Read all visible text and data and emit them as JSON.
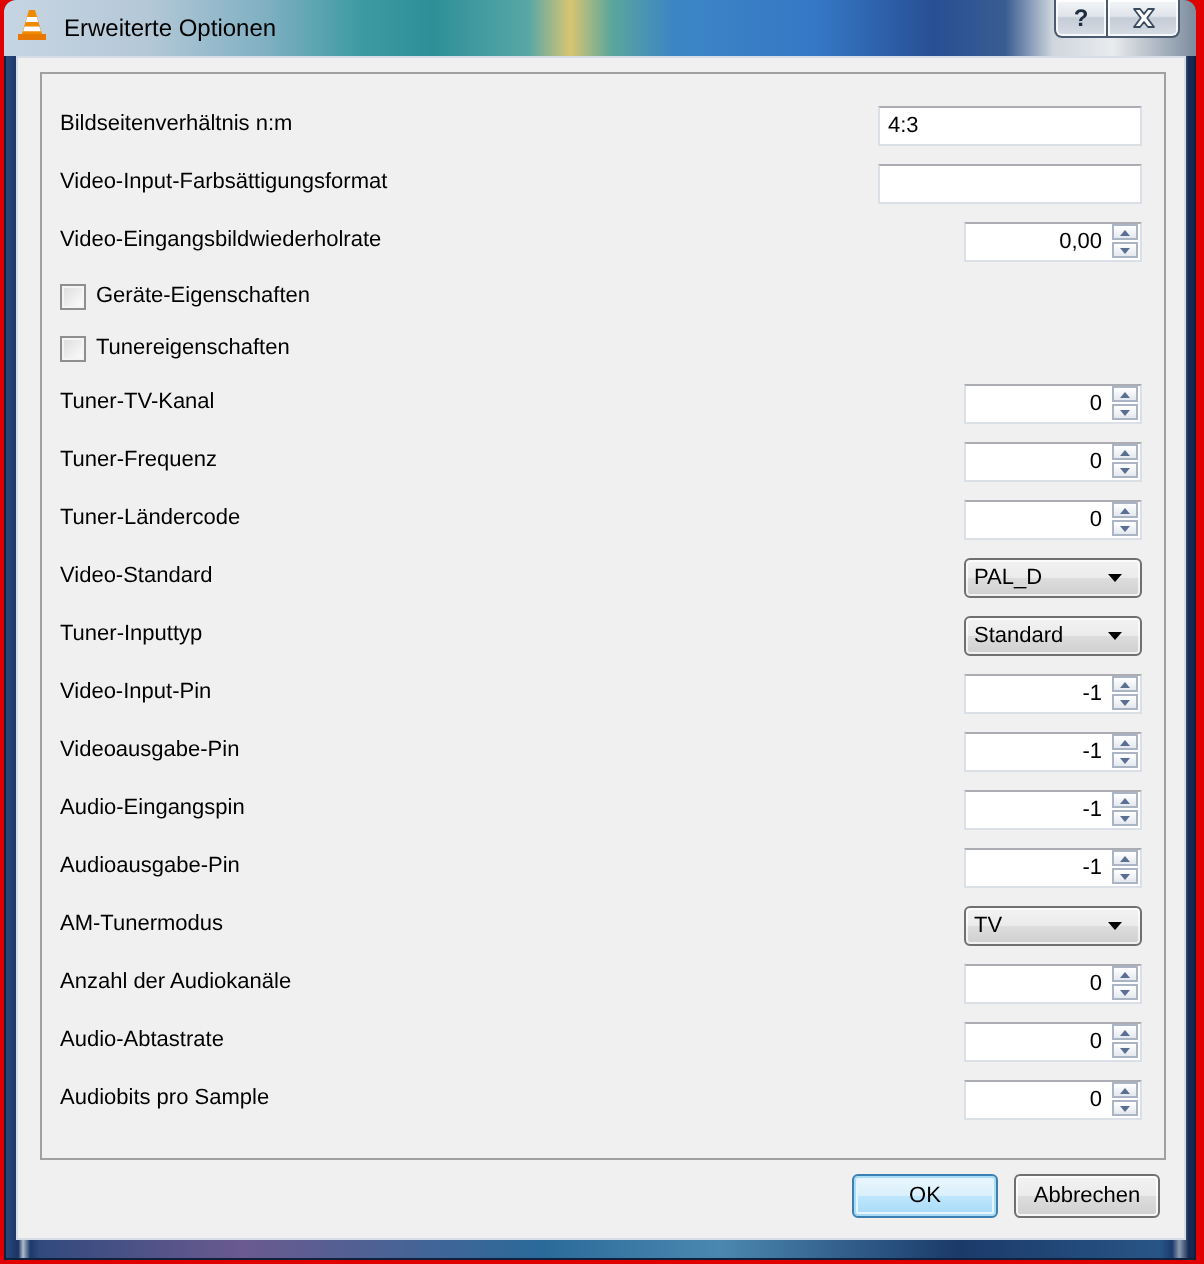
{
  "window": {
    "title": "Erweiterte Optionen",
    "help_button": "?"
  },
  "options": [
    {
      "kind": "text",
      "label": "Bildseitenverhältnis n:m",
      "value": "4:3"
    },
    {
      "kind": "text",
      "label": "Video-Input-Farbsättigungsformat"
    },
    {
      "kind": "spin",
      "label": "Video-Eingangsbildwiederholrate",
      "value": "0,00"
    },
    {
      "kind": "checkbox",
      "label": "Geräte-Eigenschaften",
      "checked": false
    },
    {
      "kind": "checkbox",
      "label": "Tunereigenschaften",
      "checked": false
    },
    {
      "kind": "spin",
      "label": "Tuner-TV-Kanal",
      "value": "0"
    },
    {
      "kind": "spin",
      "label": "Tuner-Frequenz",
      "value": "0"
    },
    {
      "kind": "spin",
      "label": "Tuner-Ländercode",
      "value": "0"
    },
    {
      "kind": "dropdown",
      "label": "Video-Standard",
      "value": "PAL_D"
    },
    {
      "kind": "dropdown",
      "label": "Tuner-Inputtyp",
      "value": "Standard"
    },
    {
      "kind": "spin",
      "label": "Video-Input-Pin",
      "value": "-1"
    },
    {
      "kind": "spin",
      "label": "Videoausgabe-Pin",
      "value": "-1"
    },
    {
      "kind": "spin",
      "label": "Audio-Eingangspin",
      "value": "-1"
    },
    {
      "kind": "spin",
      "label": "Audioausgabe-Pin",
      "value": "-1"
    },
    {
      "kind": "dropdown",
      "label": "AM-Tunermodus",
      "value": "TV"
    },
    {
      "kind": "spin",
      "label": "Anzahl der Audiokanäle",
      "value": "0"
    },
    {
      "kind": "spin",
      "label": "Audio-Abtastrate",
      "value": "0"
    },
    {
      "kind": "spin",
      "label": "Audiobits pro Sample",
      "value": "0"
    }
  ],
  "buttons": [
    {
      "label": "OK",
      "default": true
    },
    {
      "label": "Abbrechen",
      "default": false
    }
  ]
}
